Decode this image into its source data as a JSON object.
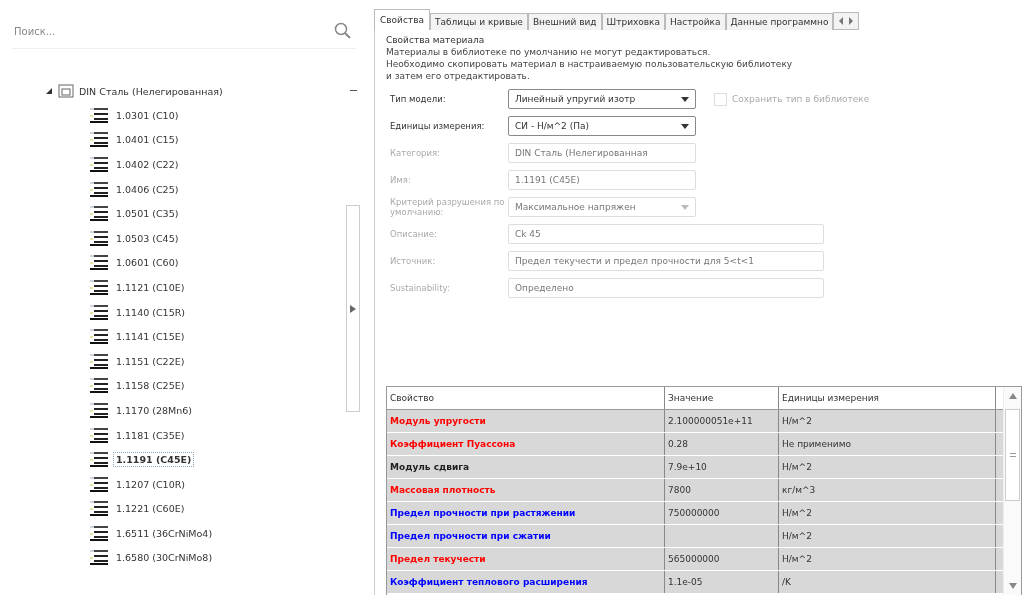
{
  "search": {
    "placeholder": "Поиск..."
  },
  "tree": {
    "label": "DIN Сталь (Нелегированная)",
    "expanded": true,
    "children": [
      {
        "label": "1.0301 (C10)",
        "selected": false
      },
      {
        "label": "1.0401 (C15)",
        "selected": false
      },
      {
        "label": "1.0402 (C22)",
        "selected": false
      },
      {
        "label": "1.0406 (C25)",
        "selected": false
      },
      {
        "label": "1.0501 (C35)",
        "selected": false
      },
      {
        "label": "1.0503 (C45)",
        "selected": false
      },
      {
        "label": "1.0601 (C60)",
        "selected": false
      },
      {
        "label": "1.1121 (C10E)",
        "selected": false
      },
      {
        "label": "1.1140 (C15R)",
        "selected": false
      },
      {
        "label": "1.1141 (C15E)",
        "selected": false
      },
      {
        "label": "1.1151 (C22E)",
        "selected": false
      },
      {
        "label": "1.1158 (C25E)",
        "selected": false
      },
      {
        "label": "1.1170 (28Mn6)",
        "selected": false
      },
      {
        "label": "1.1181 (C35E)",
        "selected": false
      },
      {
        "label": "1.1191 (C45E)",
        "selected": true
      },
      {
        "label": "1.1207 (C10R)",
        "selected": false
      },
      {
        "label": "1.1221 (C60E)",
        "selected": false
      },
      {
        "label": "1.6511 (36CrNiMo4)",
        "selected": false
      },
      {
        "label": "1.6580 (30CrNiMo8)",
        "selected": false
      }
    ]
  },
  "tabs": [
    {
      "label": "Свойства",
      "selected": true
    },
    {
      "label": "Таблицы и кривые",
      "selected": false
    },
    {
      "label": "Внешний вид",
      "selected": false
    },
    {
      "label": "Штриховка",
      "selected": false
    },
    {
      "label": "Настройка",
      "selected": false
    },
    {
      "label": "Данные программно",
      "selected": false
    }
  ],
  "section_title": "Свойства материала",
  "notice": [
    "Материалы в библиотеке по умолчанию не могут редактироваться.",
    "Необходимо скопировать материал в настраиваемую пользовательскую библиотеку",
    "и затем его отредактировать."
  ],
  "fields": [
    {
      "label": "Тип модели:",
      "kind": "dropdown",
      "value": "Линейный упругий изотр",
      "disabled": false
    },
    {
      "label": "Единицы измерения:",
      "kind": "dropdown",
      "value": "СИ - Н/м^2 (Па)",
      "disabled": false
    },
    {
      "label": "Категория:",
      "kind": "text",
      "value": "DIN Сталь (Нелегированная",
      "disabled": true
    },
    {
      "label": "Имя:",
      "kind": "text",
      "value": "1.1191 (C45E)",
      "disabled": true
    },
    {
      "label": "Критерий разрушения по умолчанию:",
      "kind": "dropdown",
      "value": "Максимальное напряжен",
      "disabled": true
    },
    {
      "label": "Описание:",
      "kind": "wide",
      "value": "Ck 45",
      "disabled": true
    },
    {
      "label": "Источник:",
      "kind": "wide",
      "value": "Предел текучести и предел прочности для 5<t<1",
      "disabled": true
    },
    {
      "label": "Sustainability:",
      "kind": "wide",
      "value": "Определено",
      "disabled": true
    }
  ],
  "save_type": {
    "label": "Сохранить тип в библиотеке",
    "checked": false,
    "disabled": true
  },
  "table": {
    "columns": [
      "Свойство",
      "Значение",
      "Единицы измерения"
    ],
    "rows": [
      {
        "property": "Модуль упругости",
        "value": "2.100000051e+11",
        "unit": "Н/м^2",
        "color": "#ff0000"
      },
      {
        "property": "Коэффициент Пуассона",
        "value": "0.28",
        "unit": "Не применимо",
        "color": "#ff0000"
      },
      {
        "property": "Модуль сдвига",
        "value": "7.9e+10",
        "unit": "Н/м^2",
        "color": "#202020"
      },
      {
        "property": "Массовая плотность",
        "value": "7800",
        "unit": "кг/м^3",
        "color": "#ff0000"
      },
      {
        "property": "Предел прочности при растяжении",
        "value": "750000000",
        "unit": "Н/м^2",
        "color": "#0000ff"
      },
      {
        "property": "Предел прочности при сжатии",
        "unit": "Н/м^2",
        "color": "#0000ff"
      },
      {
        "property": "Предел текучести",
        "value": "565000000",
        "unit": "Н/м^2",
        "color": "#ff0000"
      },
      {
        "property": "Коэффициент теплового расширения",
        "value": "1.1e-05",
        "unit": "/K",
        "color": "#0000ff"
      }
    ]
  }
}
